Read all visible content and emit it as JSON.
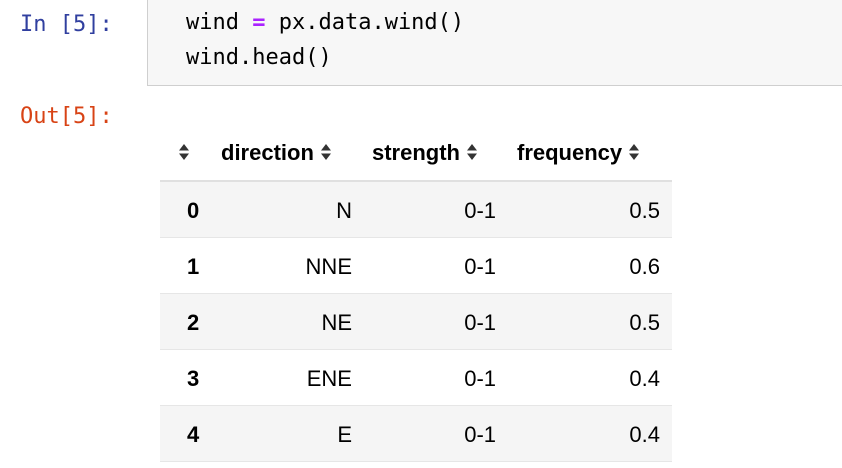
{
  "input_prompt": "In [5]:",
  "output_prompt": "Out[5]:",
  "code": {
    "line1_var": "wind",
    "line1_op": "=",
    "line1_expr": "px.data.wind()",
    "line2": "wind.head()"
  },
  "dataframe": {
    "columns": [
      "direction",
      "strength",
      "frequency"
    ],
    "rows": [
      {
        "index": "0",
        "direction": "N",
        "strength": "0-1",
        "frequency": "0.5"
      },
      {
        "index": "1",
        "direction": "NNE",
        "strength": "0-1",
        "frequency": "0.6"
      },
      {
        "index": "2",
        "direction": "NE",
        "strength": "0-1",
        "frequency": "0.5"
      },
      {
        "index": "3",
        "direction": "ENE",
        "strength": "0-1",
        "frequency": "0.4"
      },
      {
        "index": "4",
        "direction": "E",
        "strength": "0-1",
        "frequency": "0.4"
      }
    ]
  },
  "icons": {
    "sort": "sort-arrows-icon"
  },
  "colors": {
    "input_prompt": "#303f9f",
    "output_prompt": "#d84315",
    "operator": "#aa22ff",
    "cell_background": "#f7f7f7"
  }
}
